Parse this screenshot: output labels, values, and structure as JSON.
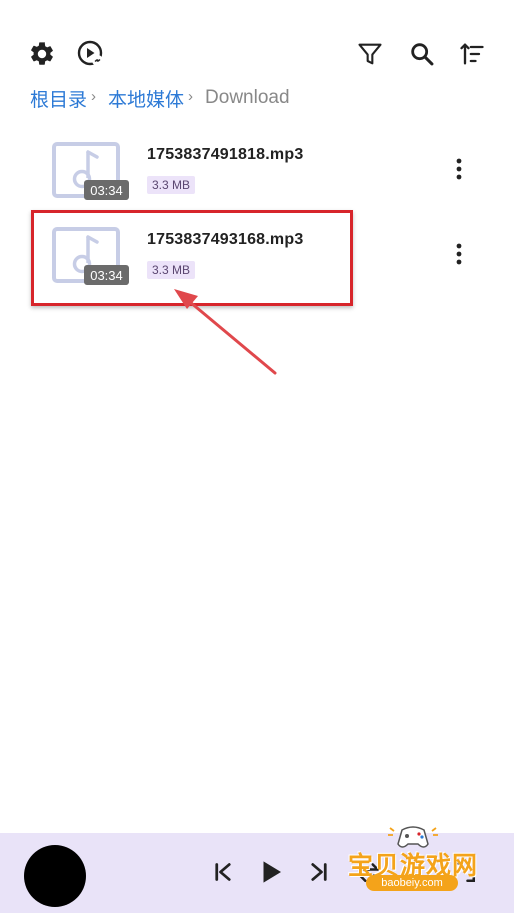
{
  "toolbar": {
    "left_icons": [
      "gear-icon",
      "play-link-icon"
    ],
    "right_icons": [
      "filter-icon",
      "search-icon",
      "sort-icon"
    ]
  },
  "breadcrumb": {
    "items": [
      {
        "label": "根目录",
        "link": true
      },
      {
        "label": "本地媒体",
        "link": true
      },
      {
        "label": "Download",
        "link": false
      }
    ],
    "separator": "›"
  },
  "files": [
    {
      "name": "1753837491818.mp3",
      "size": "3.3 MB",
      "duration": "03:34"
    },
    {
      "name": "1753837493168.mp3",
      "size": "3.3 MB",
      "duration": "03:34"
    }
  ],
  "player": {
    "controls": [
      "skip-previous-icon",
      "play-icon",
      "skip-next-icon",
      "repeat-icon",
      "fullscreen-icon"
    ]
  },
  "watermark": {
    "title": "宝贝游戏网",
    "url": "baobeiy.com"
  },
  "colors": {
    "link": "#2d7ad6",
    "highlight": "#d7252b",
    "player_bg": "#e9e3f8",
    "size_badge": "#ece3f9",
    "watermark": "#f4a31a"
  }
}
